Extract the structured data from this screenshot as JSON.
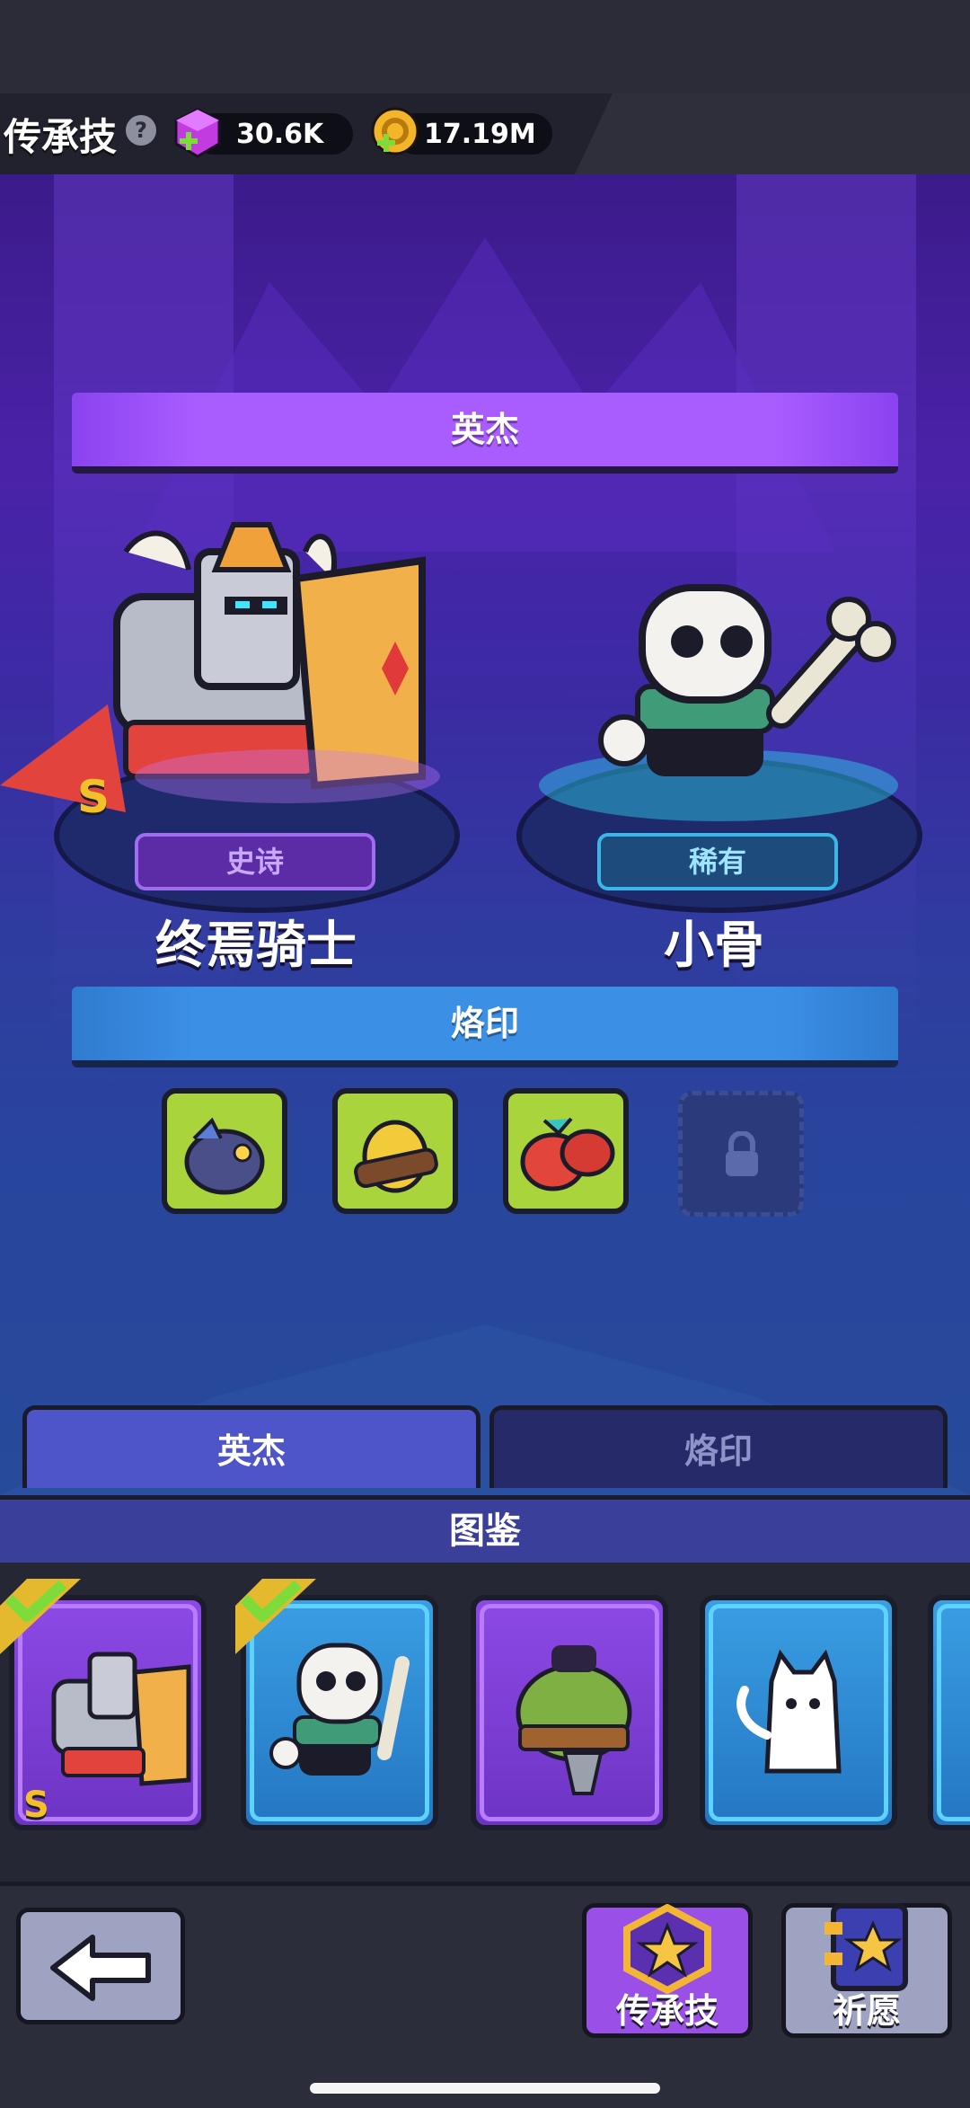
{
  "header": {
    "title": "传承技",
    "help_icon": "question-icon",
    "gems": {
      "icon": "gem-icon",
      "value": "30.6K"
    },
    "coins": {
      "icon": "coin-icon",
      "value": "17.19M"
    }
  },
  "hero_section": {
    "banner": "英杰",
    "heroes": [
      {
        "name": "终焉骑士",
        "rarity": "史诗",
        "grade": "S",
        "color": "#8a43f0"
      },
      {
        "name": "小骨",
        "rarity": "稀有",
        "grade": "",
        "color": "#2fb7d6"
      }
    ]
  },
  "seal_section": {
    "banner": "烙印",
    "slots": [
      {
        "name": "fish-creature"
      },
      {
        "name": "banana-creature"
      },
      {
        "name": "red-blob-creature"
      },
      {
        "name": "locked",
        "locked": true,
        "icon": "lock-icon"
      }
    ]
  },
  "tabs": [
    {
      "label": "英杰",
      "active": true
    },
    {
      "label": "烙印",
      "active": false
    }
  ],
  "codex": {
    "title": "图鉴",
    "cards": [
      {
        "name": "终焉骑士",
        "grade": "S",
        "owned": true,
        "color": "purple"
      },
      {
        "name": "小骨",
        "grade": "",
        "owned": true,
        "color": "blue"
      },
      {
        "name": "orc",
        "grade": "",
        "owned": false,
        "color": "purple"
      },
      {
        "name": "ghost-cat",
        "grade": "",
        "owned": false,
        "color": "blue"
      }
    ]
  },
  "bottom_bar": {
    "back_icon": "back-arrow-icon",
    "legacy_button": "传承技",
    "wish_button": "祈愿"
  }
}
